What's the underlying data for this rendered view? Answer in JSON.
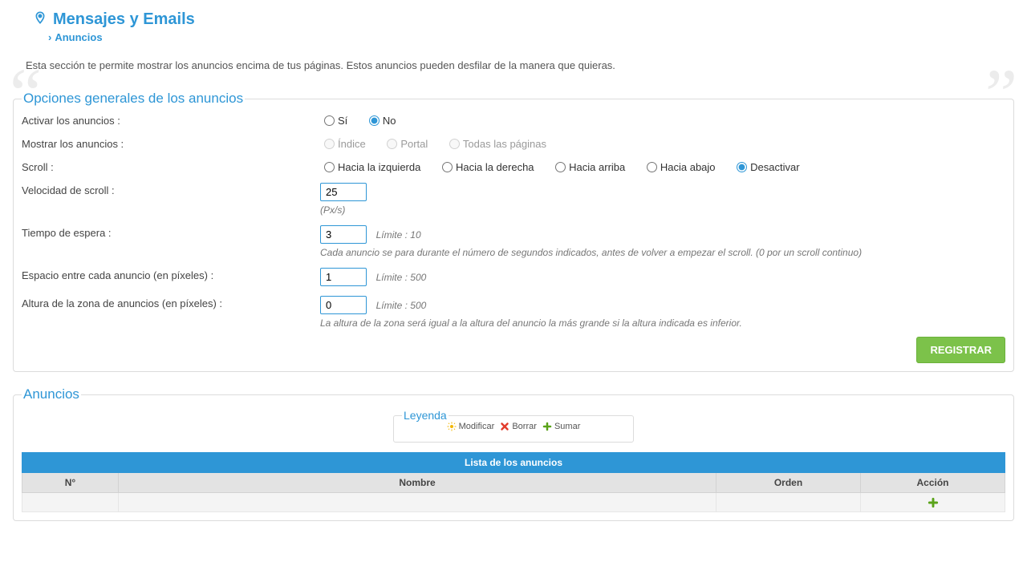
{
  "header": {
    "title": "Mensajes y Emails",
    "breadcrumb": "Anuncios"
  },
  "intro": "Esta sección te permite mostrar los anuncios encima de tus páginas. Estos anuncios pueden desfilar de la manera que quieras.",
  "panel1": {
    "legend": "Opciones generales de los anuncios",
    "rows": {
      "activate": {
        "label": "Activar los anuncios :",
        "yes": "Sí",
        "no": "No"
      },
      "show": {
        "label": "Mostrar los anuncios :",
        "opt_index": "Índice",
        "opt_portal": "Portal",
        "opt_all": "Todas las páginas"
      },
      "scroll": {
        "label": "Scroll :",
        "left": "Hacia la izquierda",
        "right": "Hacia la derecha",
        "up": "Hacia arriba",
        "down": "Hacia abajo",
        "off": "Desactivar"
      },
      "speed": {
        "label": "Velocidad de scroll :",
        "value": "25",
        "unit": "(Px/s)"
      },
      "wait": {
        "label": "Tiempo de espera :",
        "value": "3",
        "limit": "Límite : 10",
        "help": "Cada anuncio se para durante el número de segundos indicados, antes de volver a empezar el scroll. (0 por un scroll continuo)"
      },
      "gap": {
        "label": "Espacio entre cada anuncio (en píxeles) :",
        "value": "1",
        "limit": "Límite : 500"
      },
      "height": {
        "label": "Altura de la zona de anuncios (en píxeles) :",
        "value": "0",
        "limit": "Límite : 500",
        "help": "La altura de la zona será igual a la altura del anuncio la más grande si la altura indicada es inferior."
      }
    },
    "submit": "REGISTRAR"
  },
  "panel2": {
    "legend": "Anuncios",
    "legend_box": {
      "title": "Leyenda",
      "modify": "Modificar",
      "delete": "Borrar",
      "add": "Sumar"
    },
    "table": {
      "title": "Lista de los anuncios",
      "cols": {
        "num": "N°",
        "name": "Nombre",
        "order": "Orden",
        "action": "Acción"
      }
    }
  }
}
